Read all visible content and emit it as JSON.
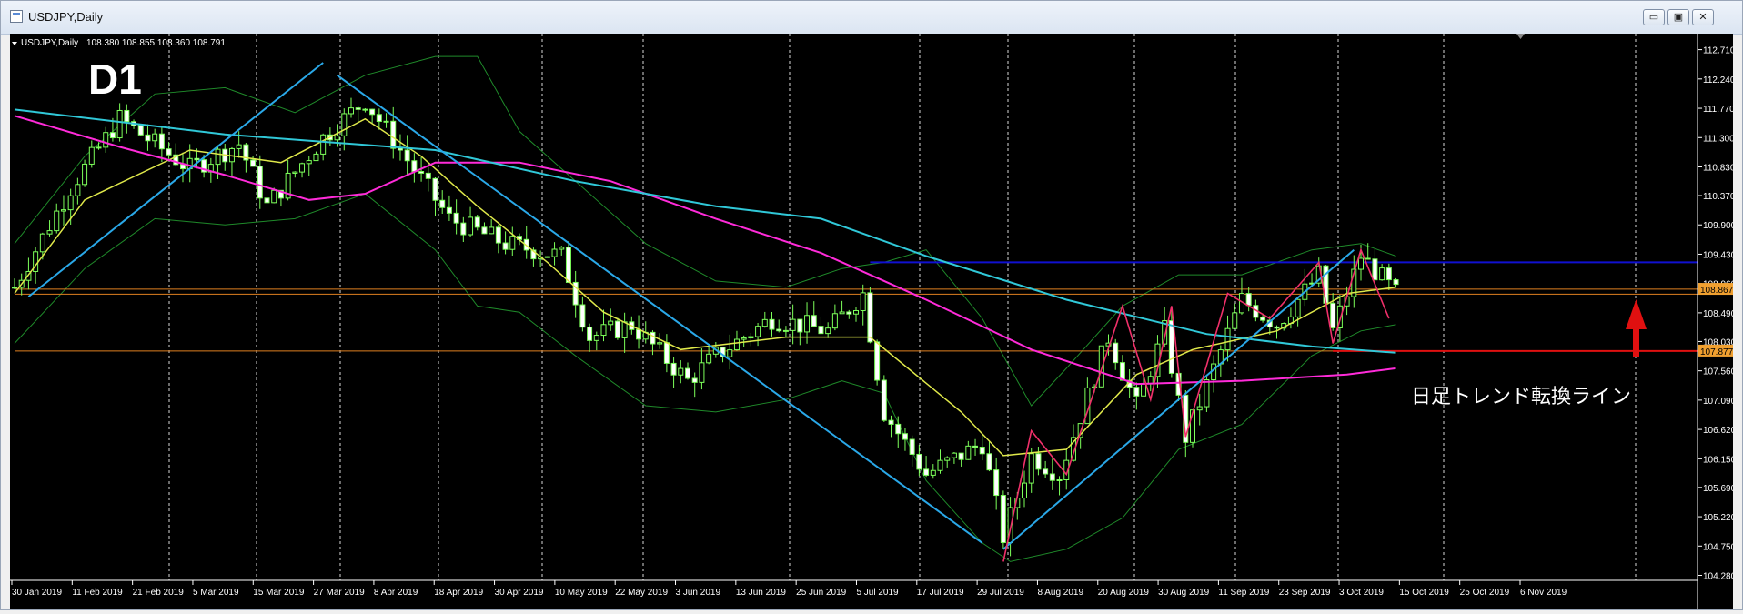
{
  "window": {
    "title": "USDJPY,Daily",
    "minimize_label": "▭",
    "restore_label": "▣",
    "close_label": "✕"
  },
  "chart_data": {
    "type": "candlestick",
    "header": "USDJPY,Daily",
    "ohlc_readout": "108.380 108.855 108.360 108.791",
    "timeframe_badge": "D1",
    "annotation": "日足トレンド転換ライン",
    "current_price_label": "108.867",
    "line_price_label": "107.877",
    "ylim": [
      104.2,
      112.85
    ],
    "y_ticks": [
      "112.710",
      "112.240",
      "111.770",
      "111.300",
      "110.830",
      "110.370",
      "109.900",
      "109.430",
      "108.960",
      "108.490",
      "108.030",
      "107.560",
      "107.090",
      "106.620",
      "106.150",
      "105.690",
      "105.220",
      "104.750",
      "104.280"
    ],
    "x_labels": [
      "30 Jan 2019",
      "11 Feb 2019",
      "21 Feb 2019",
      "5 Mar 2019",
      "15 Mar 2019",
      "27 Mar 2019",
      "8 Apr 2019",
      "18 Apr 2019",
      "30 Apr 2019",
      "10 May 2019",
      "22 May 2019",
      "3 Jun 2019",
      "13 Jun 2019",
      "25 Jun 2019",
      "5 Jul 2019",
      "17 Jul 2019",
      "29 Jul 2019",
      "8 Aug 2019",
      "20 Aug 2019",
      "30 Aug 2019",
      "11 Sep 2019",
      "23 Sep 2019",
      "3 Oct 2019",
      "15 Oct 2019",
      "25 Oct 2019",
      "6 Nov 2019"
    ],
    "waypoints": [
      {
        "t": 0,
        "p": 108.9
      },
      {
        "t": 8,
        "p": 110.5
      },
      {
        "t": 15,
        "p": 111.6
      },
      {
        "t": 25,
        "p": 110.8
      },
      {
        "t": 32,
        "p": 111.2
      },
      {
        "t": 36,
        "p": 110.2
      },
      {
        "t": 44,
        "p": 111.3
      },
      {
        "t": 50,
        "p": 111.9
      },
      {
        "t": 55,
        "p": 111.1
      },
      {
        "t": 62,
        "p": 110.0
      },
      {
        "t": 70,
        "p": 109.6
      },
      {
        "t": 78,
        "p": 109.4
      },
      {
        "t": 82,
        "p": 108.1
      },
      {
        "t": 88,
        "p": 108.3
      },
      {
        "t": 96,
        "p": 107.4
      },
      {
        "t": 100,
        "p": 107.8
      },
      {
        "t": 108,
        "p": 108.4
      },
      {
        "t": 116,
        "p": 108.2
      },
      {
        "t": 121,
        "p": 108.8
      },
      {
        "t": 124,
        "p": 106.9
      },
      {
        "t": 130,
        "p": 105.9
      },
      {
        "t": 138,
        "p": 106.4
      },
      {
        "t": 141,
        "p": 104.9
      },
      {
        "t": 145,
        "p": 106.2
      },
      {
        "t": 149,
        "p": 105.9
      },
      {
        "t": 156,
        "p": 108.1
      },
      {
        "t": 160,
        "p": 107.0
      },
      {
        "t": 164,
        "p": 108.2
      },
      {
        "t": 167,
        "p": 106.5
      },
      {
        "t": 171,
        "p": 107.6
      },
      {
        "t": 175,
        "p": 108.7
      },
      {
        "t": 180,
        "p": 108.3
      },
      {
        "t": 186,
        "p": 109.1
      },
      {
        "t": 188,
        "p": 108.2
      },
      {
        "t": 192,
        "p": 109.4
      },
      {
        "t": 197,
        "p": 108.8
      }
    ],
    "series": [
      {
        "name": "MA short",
        "color": "#dfe84a",
        "values": [
          [
            0,
            108.8
          ],
          [
            10,
            110.3
          ],
          [
            25,
            111.1
          ],
          [
            38,
            110.9
          ],
          [
            50,
            111.6
          ],
          [
            58,
            111.0
          ],
          [
            66,
            110.2
          ],
          [
            76,
            109.3
          ],
          [
            84,
            108.5
          ],
          [
            95,
            107.9
          ],
          [
            110,
            108.1
          ],
          [
            122,
            108.1
          ],
          [
            135,
            106.9
          ],
          [
            141,
            106.2
          ],
          [
            150,
            106.3
          ],
          [
            160,
            107.5
          ],
          [
            168,
            107.9
          ],
          [
            180,
            108.2
          ],
          [
            190,
            108.8
          ],
          [
            197,
            108.9
          ]
        ]
      },
      {
        "name": "MA medium",
        "color": "#ff2bd9",
        "values": [
          [
            0,
            111.65
          ],
          [
            15,
            111.15
          ],
          [
            30,
            110.7
          ],
          [
            42,
            110.3
          ],
          [
            50,
            110.4
          ],
          [
            60,
            110.9
          ],
          [
            72,
            110.9
          ],
          [
            85,
            110.6
          ],
          [
            100,
            110.0
          ],
          [
            115,
            109.45
          ],
          [
            130,
            108.7
          ],
          [
            145,
            107.9
          ],
          [
            160,
            107.35
          ],
          [
            175,
            107.4
          ],
          [
            190,
            107.5
          ],
          [
            197,
            107.6
          ]
        ]
      },
      {
        "name": "MA long",
        "color": "#30c8d8",
        "values": [
          [
            0,
            111.75
          ],
          [
            30,
            111.35
          ],
          [
            60,
            111.1
          ],
          [
            80,
            110.6
          ],
          [
            100,
            110.2
          ],
          [
            115,
            110.0
          ],
          [
            130,
            109.4
          ],
          [
            150,
            108.7
          ],
          [
            170,
            108.15
          ],
          [
            185,
            107.95
          ],
          [
            197,
            107.85
          ]
        ]
      },
      {
        "name": "Bollinger upper",
        "color": "#1f8a2a",
        "values": [
          [
            0,
            109.6
          ],
          [
            10,
            111.0
          ],
          [
            20,
            112.0
          ],
          [
            30,
            112.1
          ],
          [
            40,
            111.7
          ],
          [
            50,
            112.3
          ],
          [
            60,
            112.6
          ],
          [
            66,
            112.6
          ],
          [
            72,
            111.4
          ],
          [
            80,
            110.6
          ],
          [
            90,
            109.6
          ],
          [
            100,
            109.0
          ],
          [
            110,
            108.9
          ],
          [
            118,
            109.2
          ],
          [
            124,
            109.3
          ],
          [
            130,
            109.5
          ],
          [
            138,
            108.4
          ],
          [
            145,
            107.0
          ],
          [
            150,
            107.6
          ],
          [
            158,
            108.6
          ],
          [
            166,
            109.1
          ],
          [
            175,
            109.1
          ],
          [
            185,
            109.5
          ],
          [
            192,
            109.6
          ],
          [
            197,
            109.4
          ]
        ]
      },
      {
        "name": "Bollinger lower",
        "color": "#1f8a2a",
        "values": [
          [
            0,
            108.0
          ],
          [
            10,
            109.2
          ],
          [
            20,
            110.0
          ],
          [
            30,
            109.9
          ],
          [
            40,
            110.0
          ],
          [
            50,
            110.4
          ],
          [
            60,
            109.5
          ],
          [
            66,
            108.6
          ],
          [
            72,
            108.5
          ],
          [
            80,
            107.8
          ],
          [
            90,
            107.0
          ],
          [
            100,
            106.9
          ],
          [
            110,
            107.1
          ],
          [
            118,
            107.4
          ],
          [
            124,
            107.2
          ],
          [
            130,
            105.8
          ],
          [
            138,
            104.8
          ],
          [
            142,
            104.5
          ],
          [
            150,
            104.7
          ],
          [
            158,
            105.2
          ],
          [
            166,
            106.3
          ],
          [
            175,
            106.7
          ],
          [
            185,
            107.8
          ],
          [
            192,
            108.2
          ],
          [
            197,
            108.3
          ]
        ]
      }
    ],
    "trendlines_blue": [
      [
        [
          2,
          108.75
        ],
        [
          44,
          112.5
        ]
      ],
      [
        [
          46,
          112.3
        ],
        [
          138,
          104.8
        ]
      ],
      [
        [
          141,
          104.7
        ],
        [
          191,
          109.5
        ]
      ]
    ],
    "zigzag_red": [
      [
        141,
        104.5
      ],
      [
        145,
        106.6
      ],
      [
        150,
        105.9
      ],
      [
        158,
        108.6
      ],
      [
        162,
        107.1
      ],
      [
        165,
        108.6
      ],
      [
        167,
        106.5
      ],
      [
        173,
        108.8
      ],
      [
        179,
        108.4
      ],
      [
        186,
        109.3
      ],
      [
        188,
        108.0
      ],
      [
        192,
        109.5
      ],
      [
        196,
        108.4
      ]
    ],
    "levels": [
      {
        "price": 109.3,
        "color": "#1010d0",
        "from_t": 122
      },
      {
        "price": 108.87,
        "color": "#e08020",
        "from_t": 0
      },
      {
        "price": 108.79,
        "color": "#e08020",
        "from_t": 0
      },
      {
        "price": 107.877,
        "color": "#e08020",
        "from_t": 0
      },
      {
        "price": 107.877,
        "color": "#e01010",
        "from_t": 188
      }
    ]
  }
}
